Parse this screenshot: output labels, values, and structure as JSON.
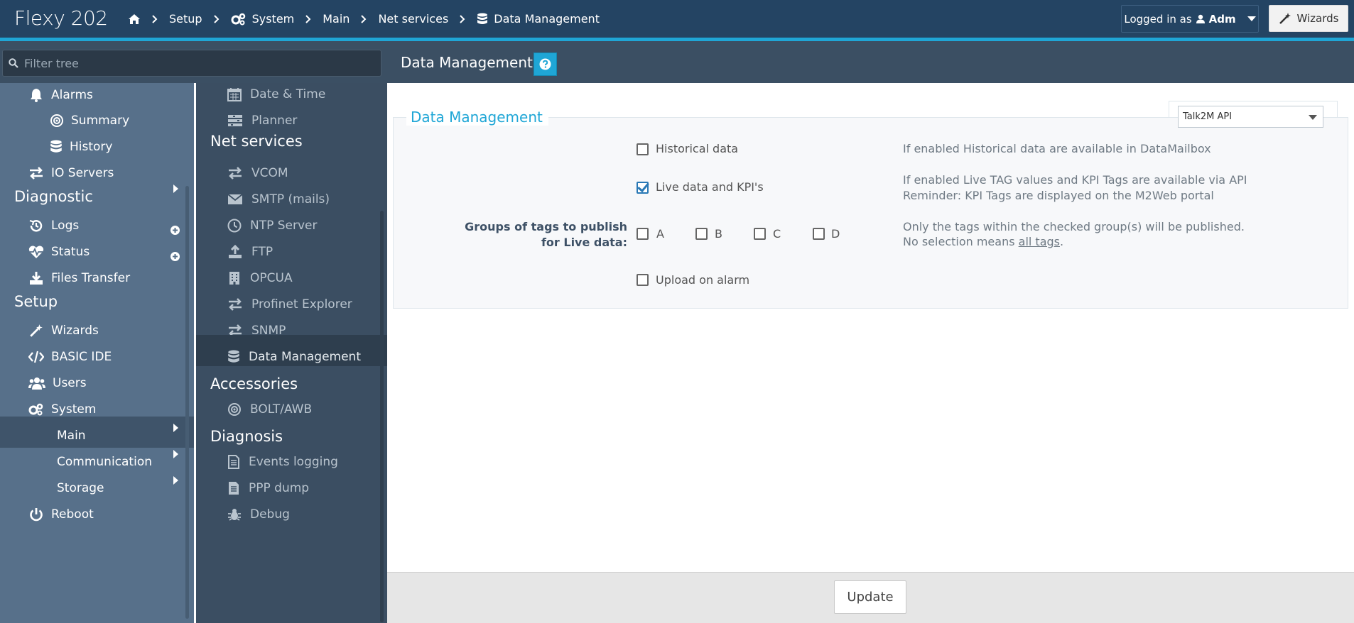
{
  "brand": {
    "name": "Flexy",
    "model": "202"
  },
  "breadcrumb": [
    {
      "label": "",
      "icon": "home-icon"
    },
    {
      "label": "Setup"
    },
    {
      "label": "System",
      "icon": "gears-icon"
    },
    {
      "label": "Main"
    },
    {
      "label": "Net services"
    },
    {
      "label": "Data Management",
      "icon": "database-icon"
    }
  ],
  "login": {
    "prefix": "Logged in as",
    "user": "Adm"
  },
  "wizards_label": "Wizards",
  "filter": {
    "placeholder": "Filter tree"
  },
  "page_title": "Data Management",
  "nav1": {
    "items": [
      {
        "label": "Alarms",
        "icon": "bell-icon"
      },
      {
        "label": "Summary",
        "icon": "target-icon"
      },
      {
        "label": "History",
        "icon": "database-icon"
      },
      {
        "label": "IO Servers",
        "icon": "exchange-icon"
      }
    ],
    "diagnostic_head": "Diagnostic",
    "diagnostic": [
      {
        "label": "Logs",
        "icon": "history-icon"
      },
      {
        "label": "Status",
        "icon": "heartbeat-icon"
      },
      {
        "label": "Files Transfer",
        "icon": "download-icon"
      }
    ],
    "setup_head": "Setup",
    "setup": [
      {
        "label": "Wizards",
        "icon": "magic-wand-icon"
      },
      {
        "label": "BASIC IDE",
        "icon": "code-icon"
      },
      {
        "label": "Users",
        "icon": "users-icon"
      },
      {
        "label": "System",
        "icon": "gears-icon"
      }
    ],
    "system_children": [
      {
        "label": "Main"
      },
      {
        "label": "Communication"
      },
      {
        "label": "Storage"
      }
    ],
    "reboot": {
      "label": "Reboot",
      "icon": "power-icon"
    }
  },
  "nav2": {
    "top_items": [
      {
        "label": "Date & Time",
        "icon": "calendar-icon"
      },
      {
        "label": "Planner",
        "icon": "planner-icon"
      }
    ],
    "net_head": "Net services",
    "net_items": [
      {
        "label": "VCOM",
        "icon": "exchange-icon"
      },
      {
        "label": "SMTP (mails)",
        "icon": "envelope-icon"
      },
      {
        "label": "NTP Server",
        "icon": "clock-icon"
      },
      {
        "label": "FTP",
        "icon": "upload-icon"
      },
      {
        "label": "OPCUA",
        "icon": "building-icon"
      },
      {
        "label": "Profinet Explorer",
        "icon": "exchange-icon"
      },
      {
        "label": "SNMP",
        "icon": "exchange-icon"
      },
      {
        "label": "Data Management",
        "icon": "database-icon"
      }
    ],
    "acc_head": "Accessories",
    "acc_items": [
      {
        "label": "BOLT/AWB",
        "icon": "target-icon"
      }
    ],
    "diag_head": "Diagnosis",
    "diag_items": [
      {
        "label": "Events logging",
        "icon": "file-text-icon"
      },
      {
        "label": "PPP dump",
        "icon": "file-text-icon"
      },
      {
        "label": "Debug",
        "icon": "bug-icon"
      }
    ]
  },
  "form": {
    "legend": "Data Management",
    "api_select": "Talk2M API",
    "historical": {
      "label": "Historical data",
      "checked": false,
      "help": "If enabled Historical data are available in DataMailbox"
    },
    "live": {
      "label": "Live data and KPI's",
      "checked": true,
      "help1": "If enabled Live TAG values and KPI Tags are available via API",
      "help2": "Reminder: KPI Tags are displayed on the M2Web portal"
    },
    "groups": {
      "label1": "Groups of tags to publish",
      "label2": "for Live data:",
      "options": [
        {
          "label": "A",
          "checked": false
        },
        {
          "label": "B",
          "checked": false
        },
        {
          "label": "C",
          "checked": false
        },
        {
          "label": "D",
          "checked": false
        }
      ],
      "help1": "Only the tags within the checked group(s) will be published.",
      "help2_prefix": "No selection means ",
      "help2_link": "all tags",
      "help2_suffix": "."
    },
    "upload": {
      "label": "Upload on alarm",
      "checked": false
    }
  },
  "update_label": "Update"
}
